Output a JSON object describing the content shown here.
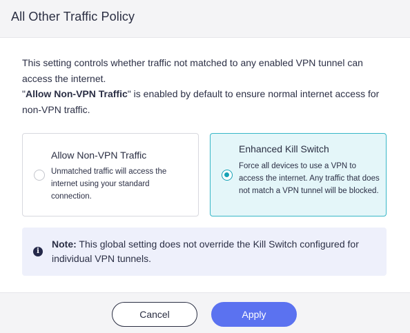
{
  "dialog": {
    "title": "All Other Traffic Policy"
  },
  "description": {
    "line1": "This setting controls whether traffic not matched to any enabled VPN tunnel can access the internet.",
    "quote_open": "\"",
    "bold_term": "Allow Non-VPN Traffic",
    "quote_close": "\"",
    "line2_rest": " is enabled by default to ensure normal internet access for non-VPN traffic."
  },
  "options": [
    {
      "title": "Allow Non-VPN Traffic",
      "text": "Unmatched traffic will access the internet using your standard connection.",
      "selected": false
    },
    {
      "title": "Enhanced Kill Switch",
      "text": "Force all devices to use a VPN to access the internet. Any traffic that does not match a VPN tunnel will be blocked.",
      "selected": true
    }
  ],
  "note": {
    "icon": "info-icon",
    "label": "Note:",
    "text": " This global setting does not override the Kill Switch configured for individual VPN tunnels."
  },
  "footer": {
    "cancel_label": "Cancel",
    "apply_label": "Apply"
  },
  "colors": {
    "accent": "#5b72f0",
    "selected_border": "#36b6c7",
    "selected_bg": "#e4f6f9",
    "note_bg": "#eef0fb"
  }
}
